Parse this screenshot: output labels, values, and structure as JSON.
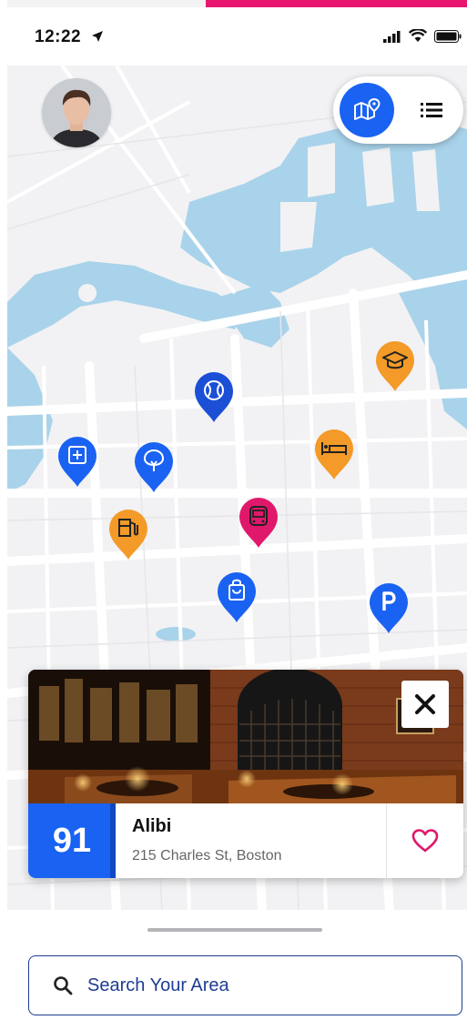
{
  "status_bar": {
    "time": "12:22"
  },
  "map_view": {
    "active_mode": "map"
  },
  "pins": [
    {
      "name": "education-pin",
      "color": "#f39a28",
      "icon": "graduation-cap-icon"
    },
    {
      "name": "sports-pin",
      "color": "#1a4fd6",
      "icon": "tennis-ball-icon"
    },
    {
      "name": "hotel-pin",
      "color": "#f39a28",
      "icon": "bed-icon"
    },
    {
      "name": "hospital-pin",
      "color": "#1a62f2",
      "icon": "medical-plus-icon"
    },
    {
      "name": "park-pin",
      "color": "#1a62f2",
      "icon": "tree-icon"
    },
    {
      "name": "gas-station-pin",
      "color": "#f39a28",
      "icon": "fuel-pump-icon"
    },
    {
      "name": "transit-pin",
      "color": "#e0186b",
      "icon": "bus-icon"
    },
    {
      "name": "shopping-pin",
      "color": "#1a62f2",
      "icon": "shopping-bag-icon"
    },
    {
      "name": "parking-pin",
      "color": "#1a62f2",
      "icon": "parking-icon"
    }
  ],
  "place_card": {
    "score": "91",
    "name": "Alibi",
    "address": "215 Charles St, Boston"
  },
  "search": {
    "placeholder": "Search Your Area"
  },
  "colors": {
    "accent": "#1a62f2",
    "pink": "#e0186b",
    "orange": "#f39a28",
    "water": "#a9d3ea"
  }
}
